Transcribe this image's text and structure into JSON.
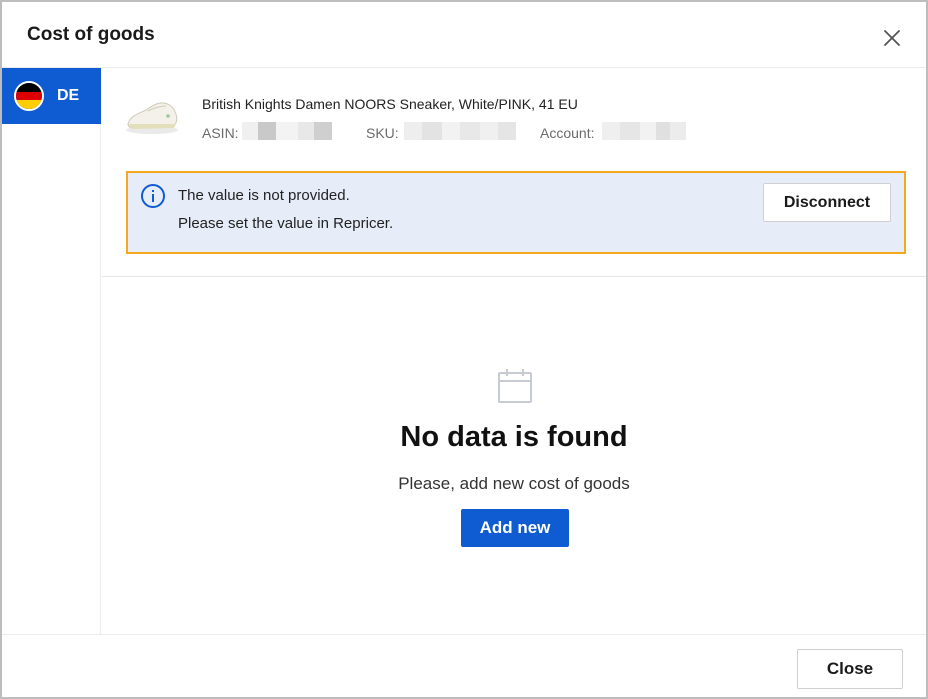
{
  "dialog": {
    "title": "Cost of goods",
    "close_icon": "close-icon"
  },
  "sidebar": {
    "tabs": [
      {
        "label": "DE",
        "flag_icon": "germany-flag-icon",
        "active": true
      }
    ]
  },
  "product": {
    "name": "British Knights Damen NOORS Sneaker, White/PINK, 41 EU",
    "asin_label": "ASIN:",
    "sku_label": "SKU:",
    "account_label": "Account:"
  },
  "alert": {
    "icon": "info-icon",
    "line1": "The value is not provided.",
    "line2": "Please set the value in Repricer.",
    "action_label": "Disconnect",
    "border_color": "#f4a81d",
    "background": "#e6edf8"
  },
  "empty_state": {
    "icon": "calendar-icon",
    "title": "No data is found",
    "subtitle": "Please, add new cost of goods",
    "action_label": "Add new"
  },
  "footer": {
    "close_label": "Close"
  },
  "colors": {
    "accent": "#0f5bd1"
  }
}
